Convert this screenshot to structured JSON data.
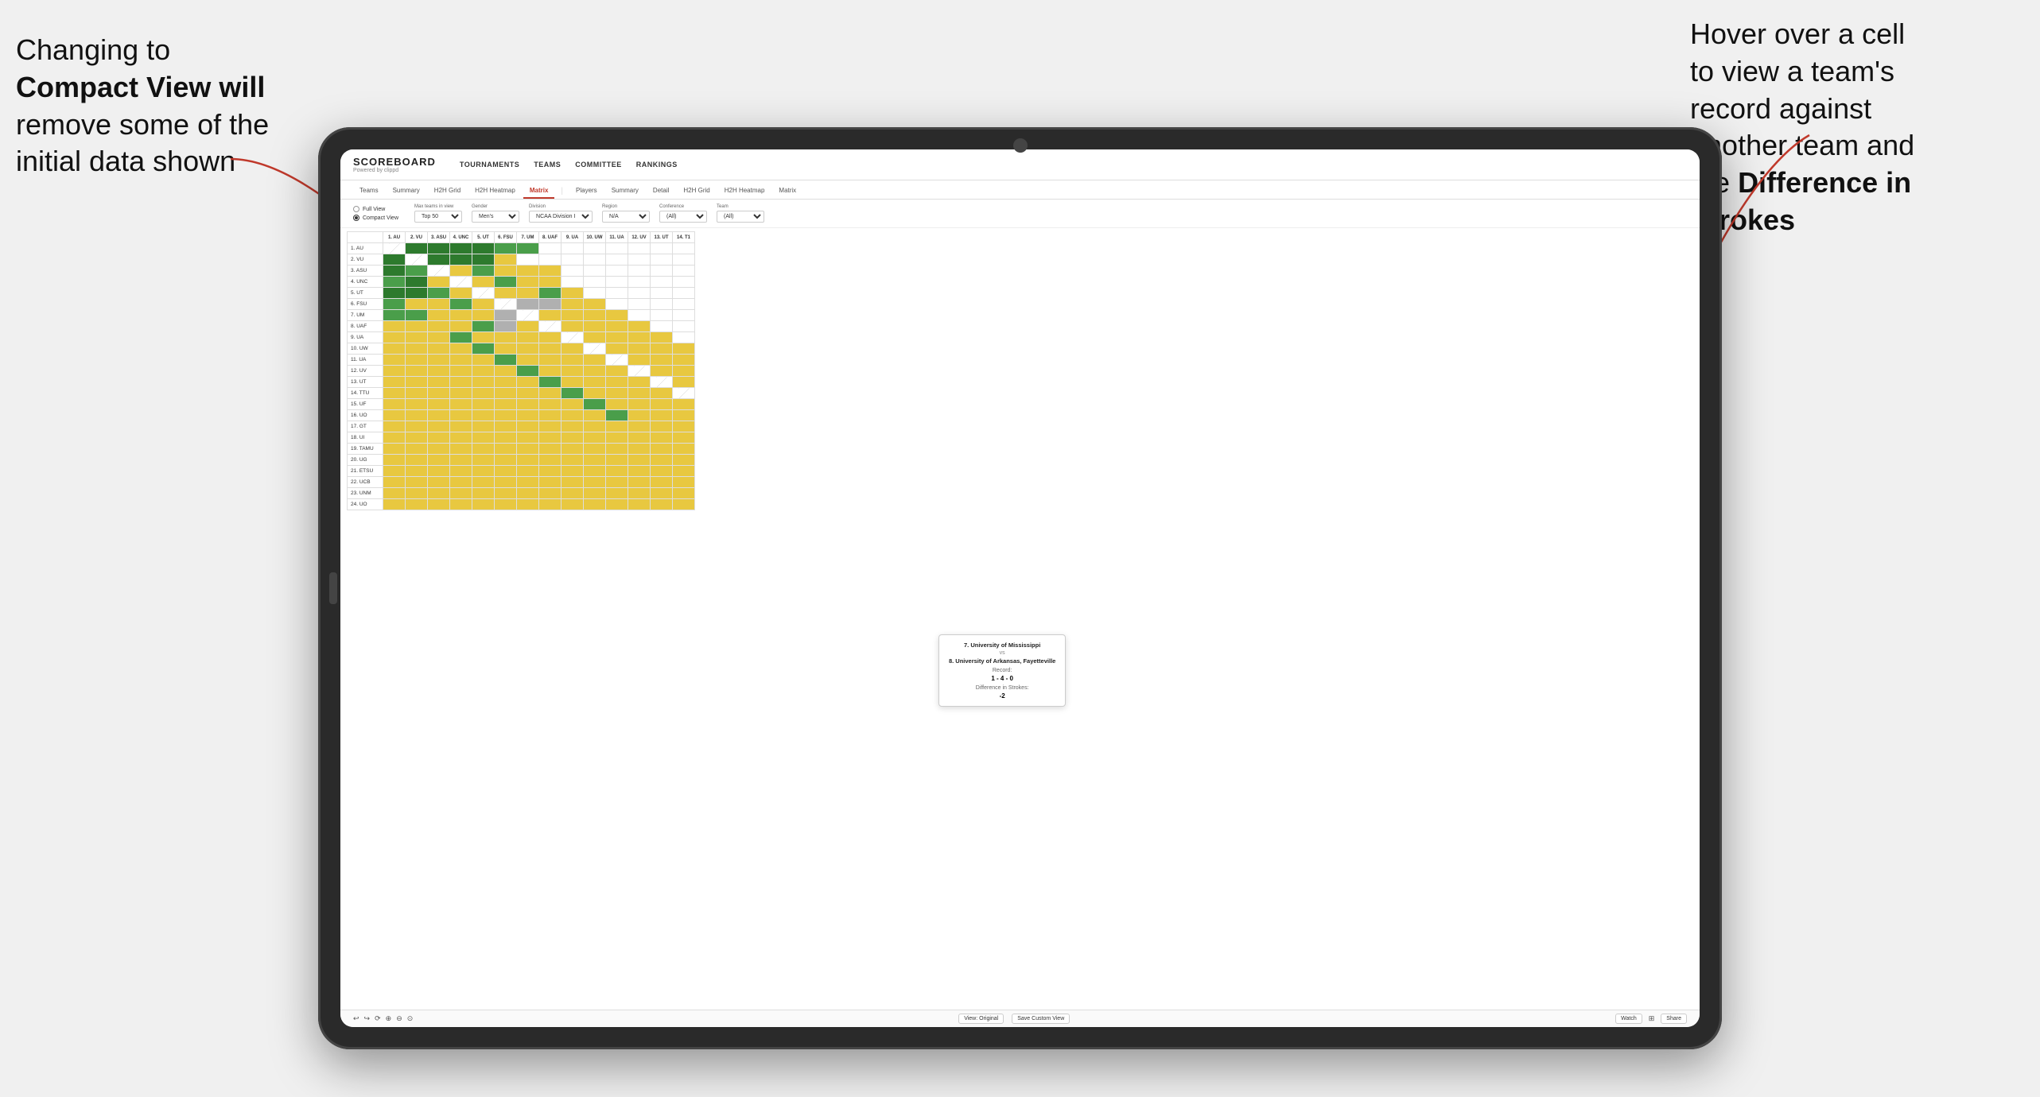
{
  "annotations": {
    "left": {
      "line1": "Changing to",
      "line2": "Compact View will",
      "line3": "remove some of the",
      "line4": "initial data shown"
    },
    "right": {
      "line1": "Hover over a cell",
      "line2": "to view a team's",
      "line3": "record against",
      "line4": "another team and",
      "line5": "the",
      "line6": "Difference in",
      "line7": "Strokes"
    }
  },
  "nav": {
    "logo": "SCOREBOARD",
    "logo_sub": "Powered by clippd",
    "items": [
      "TOURNAMENTS",
      "TEAMS",
      "COMMITTEE",
      "RANKINGS"
    ]
  },
  "sub_tabs": {
    "groups": [
      {
        "label": "Teams",
        "tabs": [
          "Summary",
          "H2H Grid",
          "H2H Heatmap",
          "Matrix"
        ]
      },
      {
        "label": "Players",
        "tabs": [
          "Summary",
          "Detail",
          "H2H Grid",
          "H2H Heatmap",
          "Matrix"
        ]
      }
    ],
    "active": "Matrix"
  },
  "filters": {
    "view_options": [
      "Full View",
      "Compact View"
    ],
    "selected_view": "Compact View",
    "max_teams": "Top 50",
    "gender": "Men's",
    "division": "NCAA Division I",
    "region": "N/A",
    "conference": "(All)",
    "team": "(All)"
  },
  "column_headers": [
    "1. AU",
    "2. VU",
    "3. ASU",
    "4. UNC",
    "5. UT",
    "6. FSU",
    "7. UM",
    "8. UAF",
    "9. UA",
    "10. UW",
    "11. UA",
    "12. UV",
    "13. UT",
    "14. T1"
  ],
  "row_labels": [
    "1. AU",
    "2. VU",
    "3. ASU",
    "4. UNC",
    "5. UT",
    "6. FSU",
    "7. UM",
    "8. UAF",
    "9. UA",
    "10. UW",
    "11. UA",
    "12. UV",
    "13. UT",
    "14. TTU",
    "15. UF",
    "16. UO",
    "17. GT",
    "18. UI",
    "19. TAMU",
    "20. UG",
    "21. ETSU",
    "22. UCB",
    "23. UNM",
    "24. UO"
  ],
  "tooltip": {
    "team1": "7. University of Mississippi",
    "vs": "vs",
    "team2": "8. University of Arkansas, Fayetteville",
    "record_label": "Record:",
    "record": "1 - 4 - 0",
    "diff_label": "Difference in Strokes:",
    "diff": "-2"
  },
  "toolbar": {
    "view_original": "View: Original",
    "save_custom": "Save Custom View",
    "watch": "Watch",
    "share": "Share"
  }
}
